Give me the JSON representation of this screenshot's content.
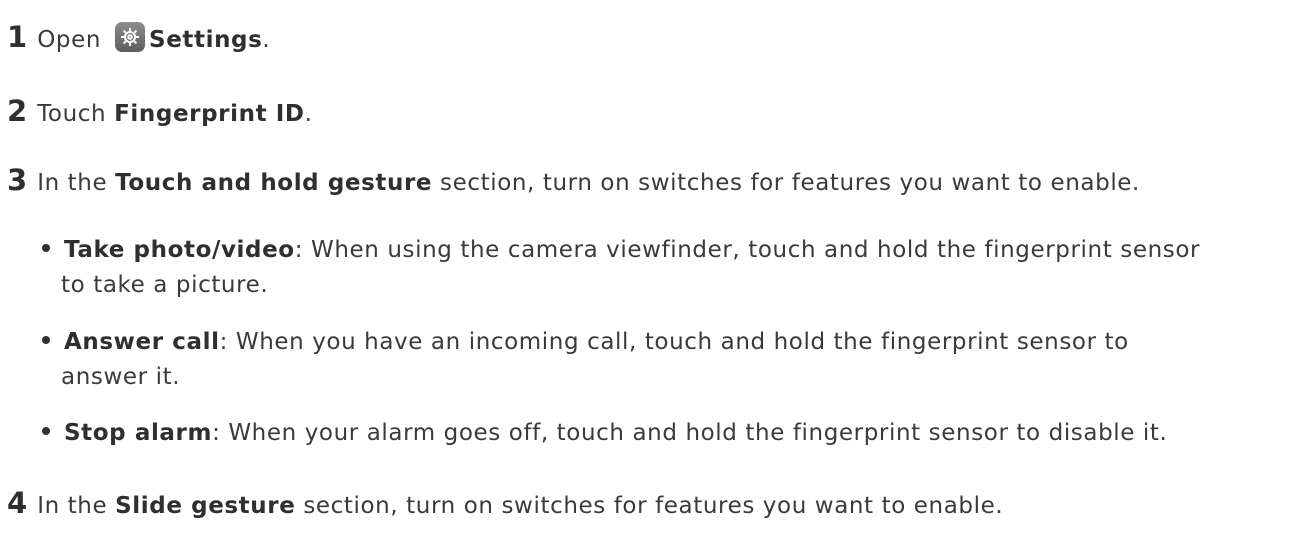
{
  "steps": [
    {
      "num": "1",
      "pre": "Open",
      "bold": "Settings",
      "post": "."
    },
    {
      "num": "2",
      "pre": "Touch ",
      "bold": "Fingerprint ID",
      "post": "."
    },
    {
      "num": "3",
      "pre": "In the ",
      "bold": "Touch and hold gesture",
      "post": " section, turn on switches for features you want to enable."
    },
    {
      "num": "4",
      "pre": "In the ",
      "bold": "Slide gesture",
      "post": " section, turn on switches for features you want to enable."
    }
  ],
  "bullets": [
    {
      "bold": "Take photo/video",
      "text": ": When using the camera viewfinder, touch and hold the fingerprint sensor",
      "cont": "to take a picture."
    },
    {
      "bold": "Answer call",
      "text": ": When you have an incoming call, touch and hold the fingerprint sensor to",
      "cont": "answer it."
    },
    {
      "bold": "Stop alarm",
      "text": ": When your alarm goes off, touch and hold the fingerprint sensor to disable it."
    }
  ],
  "icons": {
    "settings": "settings-gear-icon"
  }
}
